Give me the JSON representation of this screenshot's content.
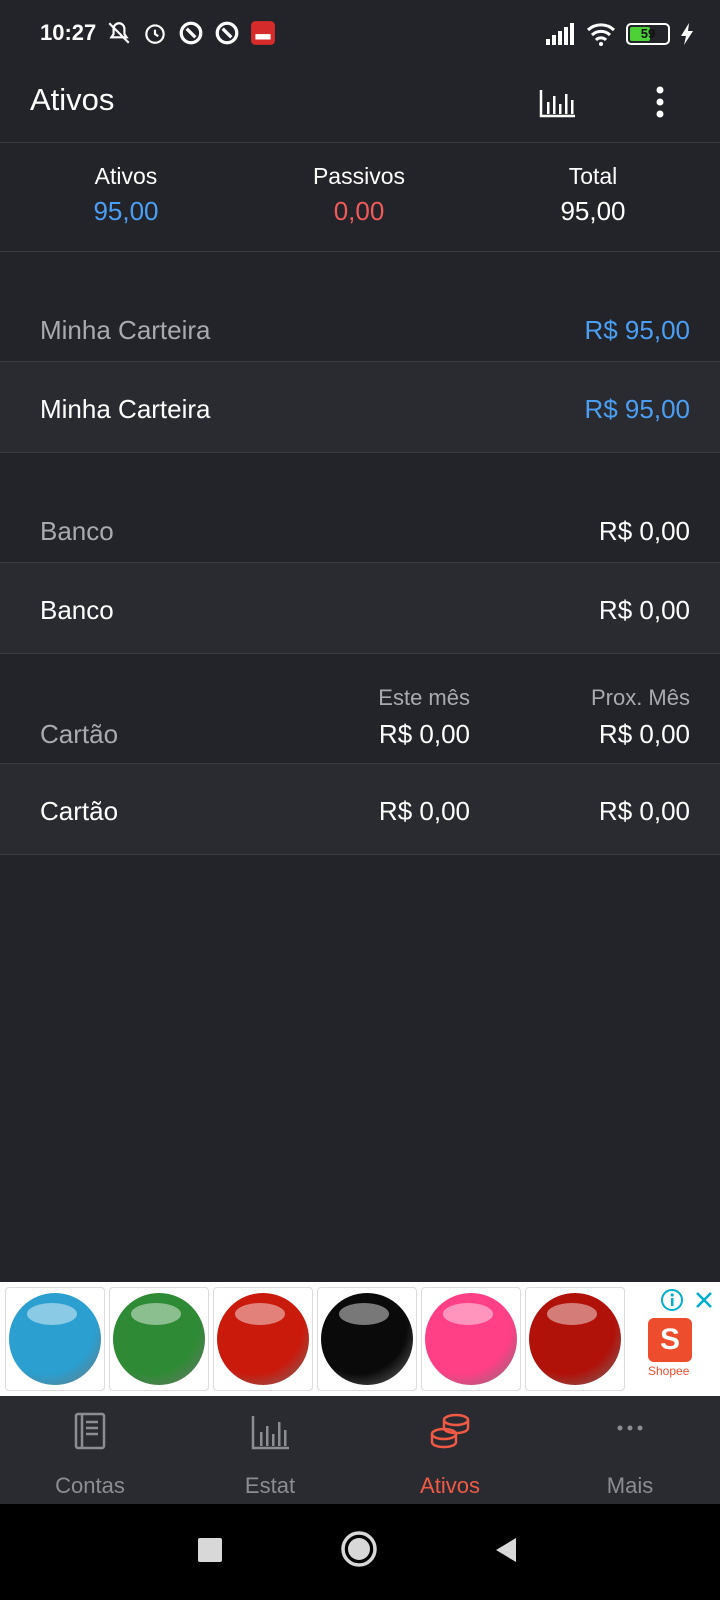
{
  "status_bar": {
    "time": "10:27",
    "battery_level": "59",
    "icons": [
      "notifications-off-icon",
      "alarm-icon",
      "data-saver-icon",
      "data-saver-icon",
      "app-notification-icon",
      "signal-icon",
      "wifi-icon",
      "battery-icon",
      "charging-icon"
    ]
  },
  "toolbar": {
    "title": "Ativos",
    "icons": [
      "bar-chart-icon",
      "more-vert-icon"
    ]
  },
  "summary": {
    "assets_label": "Ativos",
    "assets_value": "95,00",
    "liabilities_label": "Passivos",
    "liabilities_value": "0,00",
    "total_label": "Total",
    "total_value": "95,00"
  },
  "groups": {
    "wallet": {
      "header_label": "Minha Carteira",
      "header_amount": "R$ 95,00",
      "row_label": "Minha Carteira",
      "row_amount": "R$ 95,00"
    },
    "bank": {
      "header_label": "Banco",
      "header_amount": "R$ 0,00",
      "row_label": "Banco",
      "row_amount": "R$ 0,00"
    },
    "card": {
      "header_label": "Cartão",
      "this_month_label": "Este mês",
      "next_month_label": "Prox. Mês",
      "header_this_month": "R$ 0,00",
      "header_next_month": "R$ 0,00",
      "row_label": "Cartão",
      "row_this_month": "R$ 0,00",
      "row_next_month": "R$ 0,00"
    }
  },
  "ad": {
    "brand": "Shopee",
    "brand_letter": "S",
    "ball_colors": [
      "#2a9fd0",
      "#2f8a35",
      "#c91a0c",
      "#0a0a0a",
      "#ff3f86",
      "#b0120a"
    ],
    "icons": [
      "ad-info-icon",
      "ad-close-icon"
    ]
  },
  "bottom_nav": {
    "items": [
      {
        "label": "Contas",
        "icon": "book-icon"
      },
      {
        "label": "Estat",
        "icon": "bar-chart-icon"
      },
      {
        "label": "Ativos",
        "icon": "coins-icon"
      },
      {
        "label": "Mais",
        "icon": "more-horiz-icon"
      }
    ],
    "active": "Ativos"
  },
  "colors": {
    "background": "#232429",
    "row_background": "#2a2b31",
    "accent_blue": "#4a9ff5",
    "accent_red": "#f05a5a",
    "active_nav": "#f05a45"
  }
}
